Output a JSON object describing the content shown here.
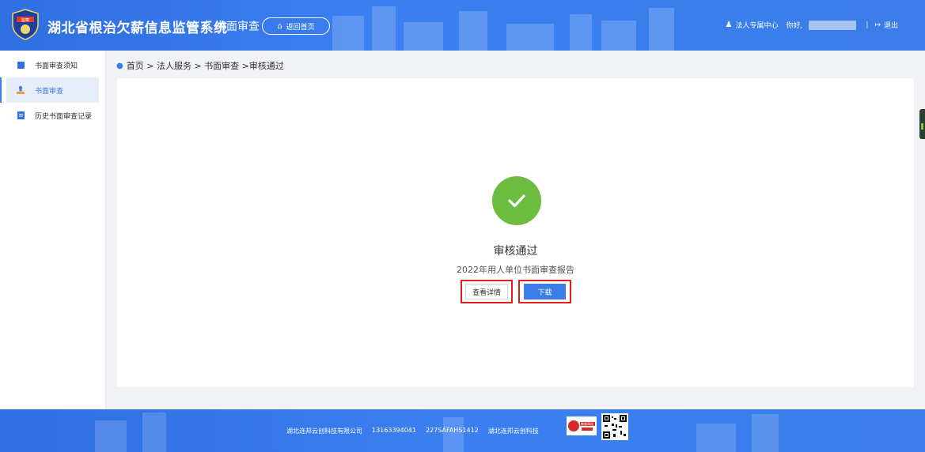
{
  "header": {
    "badge_text": "监察",
    "system_title": "湖北省根治欠薪信息监管系统",
    "separator": "|",
    "section": "书面审查",
    "home_button": "返回首页",
    "user_center": "法人专属中心",
    "greeting": "你好,",
    "bar": "|",
    "logout": "退出"
  },
  "sidebar": {
    "items": [
      {
        "label": "书面审查须知",
        "icon": "book-icon",
        "active": false
      },
      {
        "label": "书面审查",
        "icon": "stamp-icon",
        "active": true
      },
      {
        "label": "历史书面审查记录",
        "icon": "document-icon",
        "active": false
      }
    ]
  },
  "breadcrumb": {
    "text": "首页 > 法人服务 > 书面审查 >审核通过"
  },
  "result": {
    "title": "审核通过",
    "subtitle": "2022年用人单位书面审查报告",
    "detail_button": "查看详情",
    "download_button": "下载"
  },
  "footer": {
    "company": "湖北连邦云创科技有限公司",
    "phone": "13163394041",
    "code": "227SAFAHS1412",
    "brand": "湖北连邦云创科技",
    "badge_text": "教育网站"
  },
  "colors": {
    "primary": "#3a7de9",
    "success": "#6cbd3f",
    "highlight": "#e02020"
  }
}
